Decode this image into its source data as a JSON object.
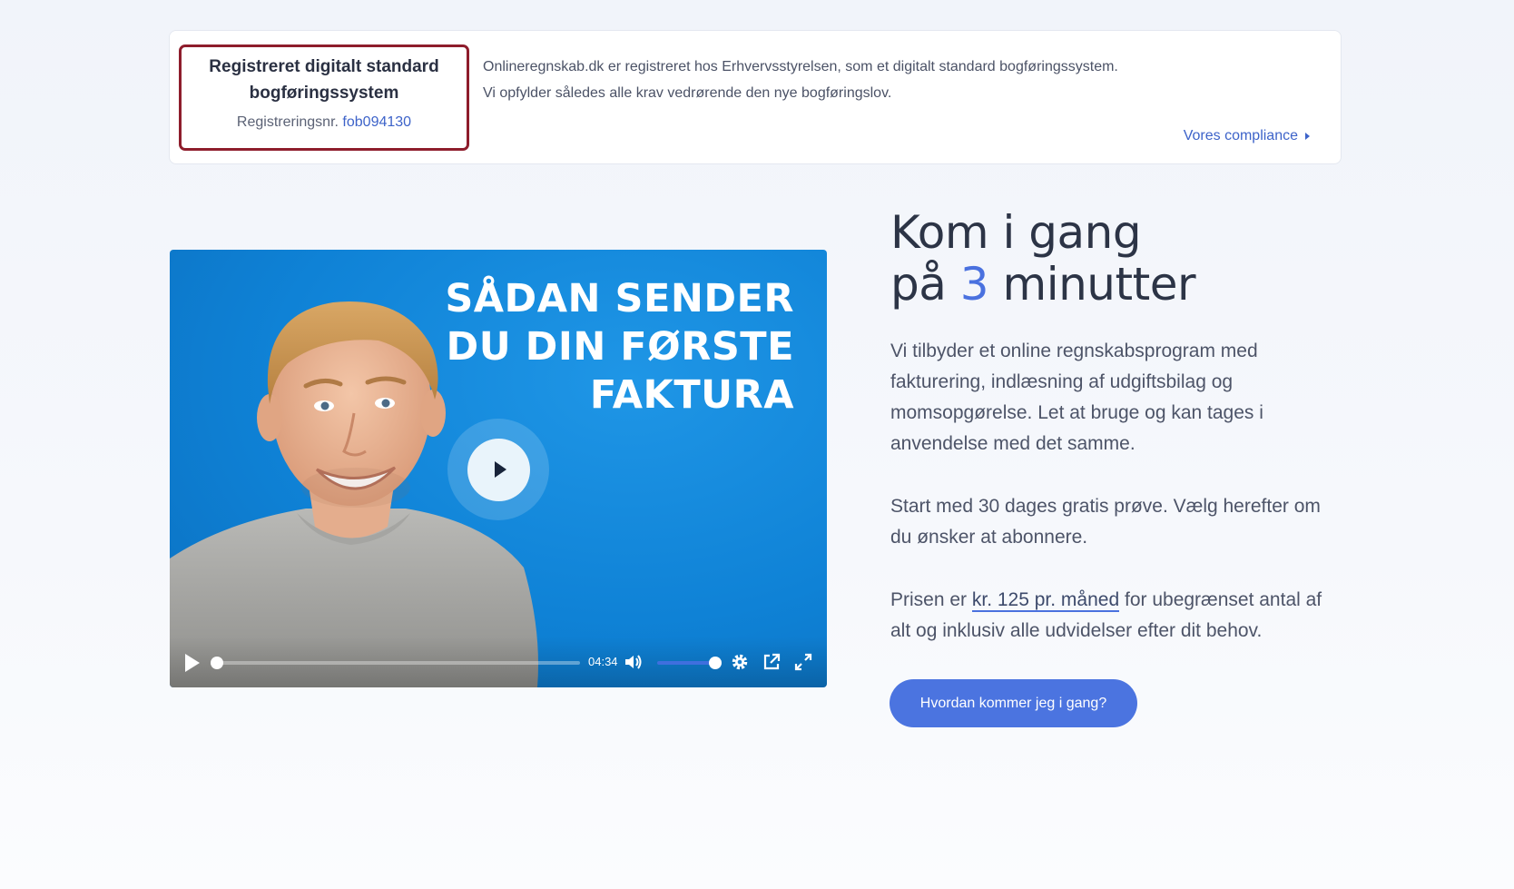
{
  "compliance": {
    "badge_title": "Registreret digitalt standard bogføringssystem",
    "reg_label": "Registreringsnr.",
    "reg_number": "fob094130",
    "line1": "Onlineregnskab.dk er registreret hos Erhvervsstyrelsen, som et digitalt standard bogføringssystem.",
    "line2": "Vi opfylder således alle krav vedrørende den nye bogføringslov.",
    "link": "Vores compliance"
  },
  "video": {
    "title_line1": "SÅDAN SENDER",
    "title_line2": "DU DIN FØRSTE",
    "title_line3": "FAKTURA",
    "duration": "04:34",
    "progress": 0,
    "volume": 1.0
  },
  "hero": {
    "headline_line1": "Kom i gang",
    "headline_pre": "på",
    "headline_num": "3",
    "headline_post": "minutter",
    "p1": "Vi tilbyder et online regnskabsprogram med fakturering, indlæsning af udgiftsbilag og momsopgørelse. Let at bruge og kan tages i anvendelse med det samme.",
    "p2": "Start med 30 dages gratis prøve. Vælg herefter om du ønsker at abonnere.",
    "p3_pre": "Prisen er",
    "p3_link": "kr. 125 pr. måned",
    "p3_post": "for ubegrænset antal af alt og inklusiv alle udvidelser efter dit behov.",
    "cta": "Hvordan kommer jeg i gang?"
  },
  "colors": {
    "accent": "#4b74e0",
    "badge_border": "#8e1d2c",
    "video_bg": "#0f82d6"
  },
  "icons": [
    "play-icon",
    "volume-icon",
    "settings-icon",
    "popout-icon",
    "fullscreen-icon",
    "caret-right-icon"
  ]
}
